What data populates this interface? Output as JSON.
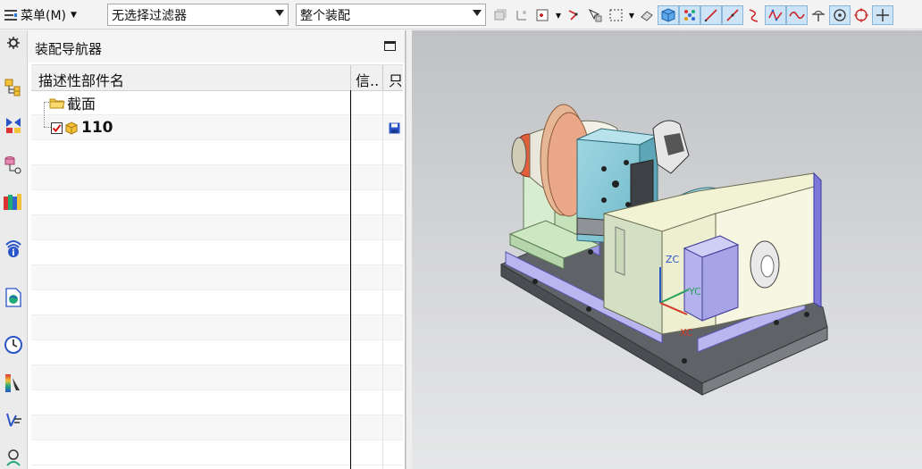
{
  "toolbar": {
    "menu_label": "菜单(M)",
    "selection_filter": "无选择过滤器",
    "scope": "整个装配",
    "icons": [
      "snap-view-icon",
      "wcs-icon",
      "filter-box-icon",
      "point-dialog-icon",
      "select-box-icon",
      "rect-select-icon",
      "erase-icon",
      "solid-body-icon",
      "feature-points-icon",
      "line-icon",
      "curve-icon",
      "spline-icon",
      "polyline-icon",
      "sine-curve-icon",
      "intersection-icon",
      "center-point-icon",
      "circle-point-icon",
      "crosshair-icon"
    ]
  },
  "navigator": {
    "title": "装配导航器",
    "columns": [
      "描述性部件名",
      "信..",
      "只"
    ],
    "tree": [
      {
        "label": "截面",
        "type": "folder"
      },
      {
        "label": "110",
        "type": "part",
        "checked": true,
        "saved_icon": true
      }
    ]
  },
  "resource_bar": {
    "icons": [
      "settings-icon",
      "assembly-navigator-icon",
      "constraint-navigator-icon",
      "part-navigator-icon",
      "reuse-library-icon",
      "hd3d-tools-icon",
      "web-browser-icon",
      "history-icon",
      "visualization-icon",
      "roles-icon",
      "process-studio-icon"
    ]
  },
  "viewport": {
    "axis_labels": {
      "z": "ZC",
      "y": "YC",
      "x": "XC"
    },
    "colors": {
      "z_axis": "#2a55c8",
      "y_axis": "#2aa05a",
      "x_axis": "#d23a2a",
      "mount_block": "#b3b2ec",
      "tailstock": "#eeeed0"
    }
  }
}
